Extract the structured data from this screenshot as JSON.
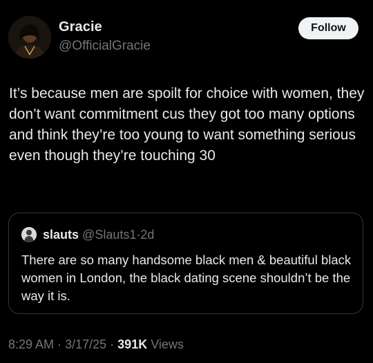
{
  "author": {
    "display_name": "Gracie",
    "handle": "@OfficialGracie",
    "avatar_icon": "profile-photo"
  },
  "follow_label": "Follow",
  "post_text": "It’s because men are spoilt for choice with women, they don’t want commitment cus they got too many options and think they’re too young to want something serious even though they’re touching 30",
  "quoted_post": {
    "display_name": "slauts",
    "handle": "@Slauts1",
    "separator": "·",
    "age": "2d",
    "text": "There are so many handsome black men & beautiful black women in London, the black dating scene shouldn’t be the way it is."
  },
  "meta": {
    "time": "8:29 AM",
    "separator": "·",
    "date": "3/17/25",
    "views_count": "391K",
    "views_label": "Views"
  },
  "colors": {
    "background": "#000000",
    "primary_text": "#e7e9ea",
    "secondary_text": "#71767b",
    "border": "#333639",
    "follow_bg": "#eff3f4"
  }
}
